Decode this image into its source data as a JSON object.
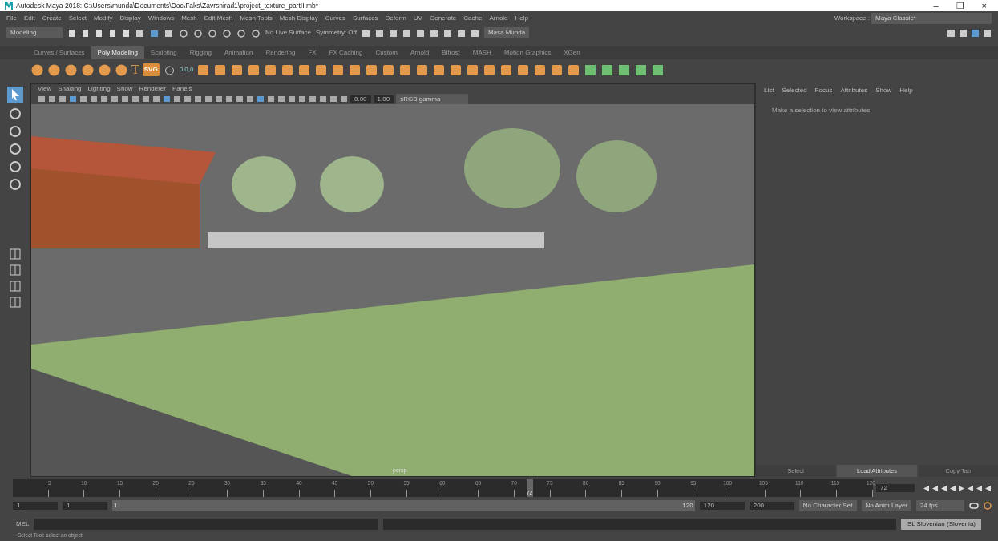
{
  "window": {
    "title": "Autodesk Maya 2018: C:\\Users\\munda\\Documents\\Doc\\Faks\\Zavrsnirad1\\project_texture_partII.mb*",
    "controls": [
      "–",
      "❐",
      "×"
    ]
  },
  "menu_bar": [
    "File",
    "Edit",
    "Create",
    "Select",
    "Modify",
    "Display",
    "Windows",
    "Mesh",
    "Edit Mesh",
    "Mesh Tools",
    "Mesh Display",
    "Curves",
    "Surfaces",
    "Deform",
    "UV",
    "Generate",
    "Cache",
    "Arnold",
    "Help"
  ],
  "workspace": {
    "label": "Workspace :",
    "value": "Maya Classic*"
  },
  "status_line": {
    "menu_set": "Modeling",
    "live_surface": "No Live Surface",
    "symmetry": "Symmetry: Off",
    "user": "Masa Munda"
  },
  "shelf": {
    "tabs": [
      {
        "label": "Curves / Surfaces",
        "selected": false
      },
      {
        "label": "Poly Modeling",
        "selected": true
      },
      {
        "label": "Sculpting",
        "selected": false
      },
      {
        "label": "Rigging",
        "selected": false
      },
      {
        "label": "Animation",
        "selected": false
      },
      {
        "label": "Rendering",
        "selected": false
      },
      {
        "label": "FX",
        "selected": false
      },
      {
        "label": "FX Caching",
        "selected": false
      },
      {
        "label": "Custom",
        "selected": false
      },
      {
        "label": "Arnold",
        "selected": false
      },
      {
        "label": "Bifrost",
        "selected": false
      },
      {
        "label": "MASH",
        "selected": false
      },
      {
        "label": "Motion Graphics",
        "selected": false
      },
      {
        "label": "XGen",
        "selected": false
      }
    ],
    "text_tools": [
      "T",
      "SVG"
    ],
    "snap_readout": "0,0,0"
  },
  "viewport": {
    "menu": [
      "View",
      "Shading",
      "Lighting",
      "Show",
      "Renderer",
      "Panels"
    ],
    "exposure": "0.00",
    "gamma": "1.00",
    "color_space": "sRGB gamma",
    "camera": "persp"
  },
  "attribute_editor": {
    "menu": [
      "List",
      "Selected",
      "Focus",
      "Attributes",
      "Show",
      "Help"
    ],
    "message": "Make a selection to view attributes",
    "buttons": [
      {
        "label": "Select",
        "disabled": true
      },
      {
        "label": "Load Attributes",
        "disabled": false
      },
      {
        "label": "Copy Tab",
        "disabled": true
      }
    ]
  },
  "time_slider": {
    "ticks": [
      "5",
      "10",
      "15",
      "20",
      "25",
      "30",
      "35",
      "40",
      "45",
      "50",
      "55",
      "60",
      "65",
      "70",
      "75",
      "80",
      "85",
      "90",
      "95",
      "100",
      "105",
      "110",
      "115",
      "120"
    ],
    "current_frame": "72",
    "level": 0.597,
    "frame_field": "72"
  },
  "range_slider": {
    "level": 1,
    "start": "1",
    "playback_start": "1",
    "range_start": "1",
    "range_end": "120",
    "playback_end": "120",
    "end": "200",
    "character_set": "No Character Set",
    "anim_layer": "No Anim Layer",
    "fps": "24 fps"
  },
  "command_line": {
    "label": "MEL",
    "language": "SL Slovenian (Slovenia)"
  },
  "help_line": "Select Tool: select an object"
}
